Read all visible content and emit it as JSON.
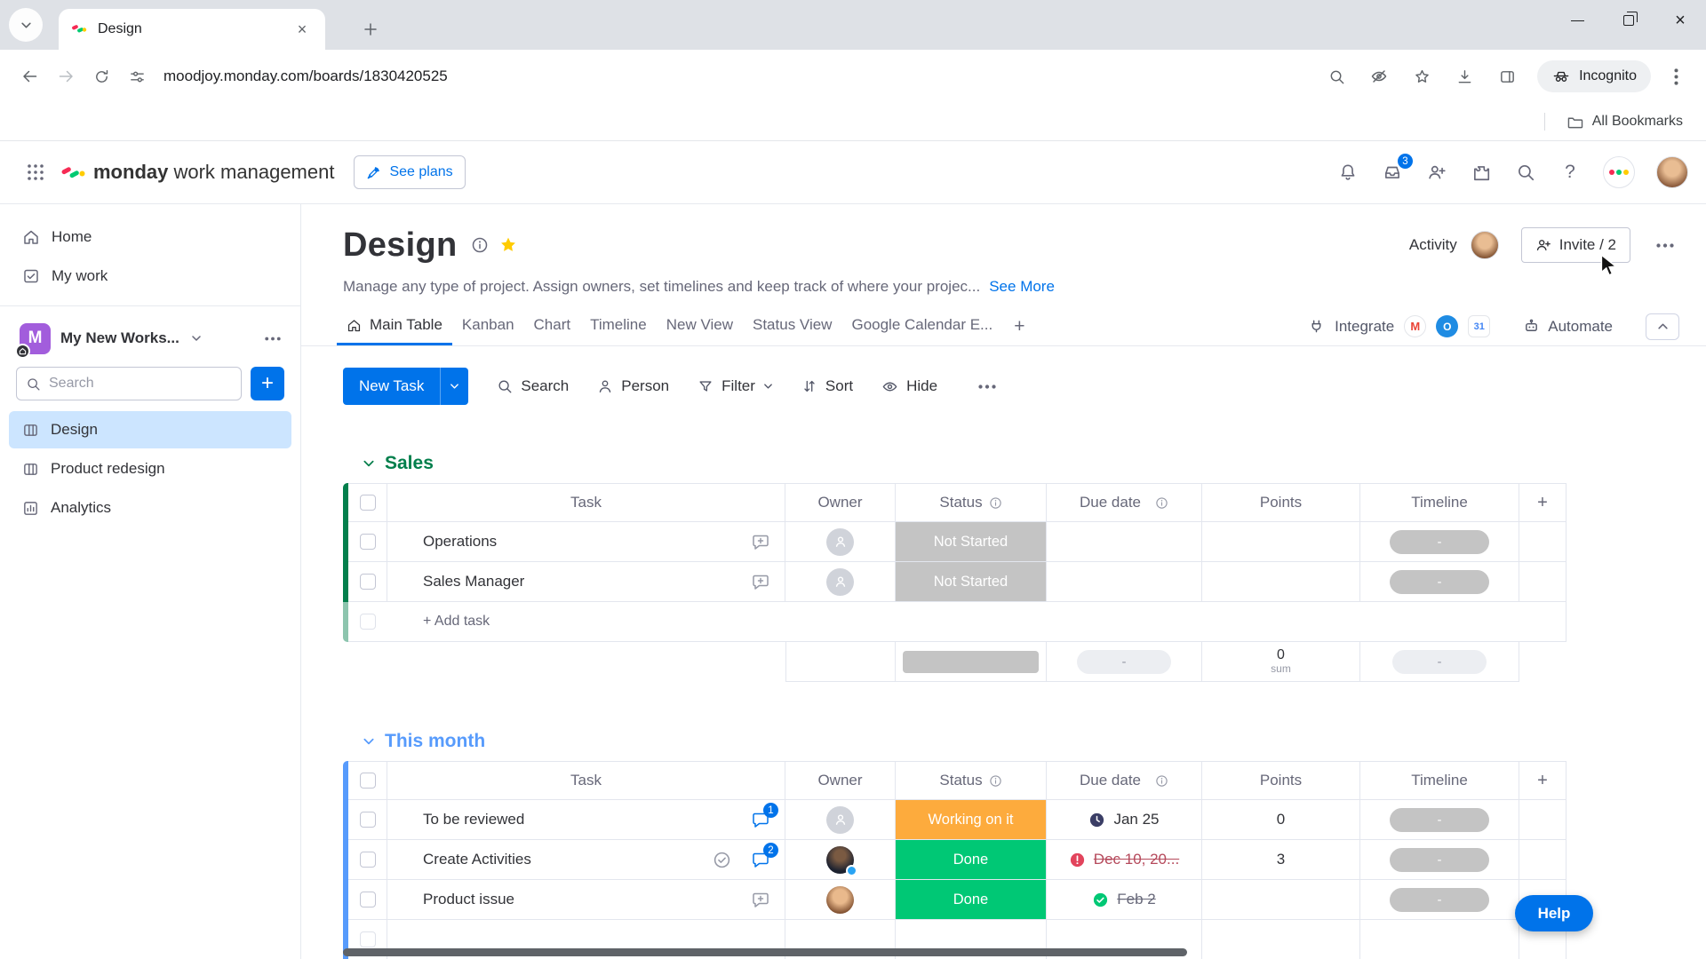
{
  "icons": {
    "plus": "+",
    "close": "×",
    "question": "?"
  },
  "colors": {
    "accent_blue": "#0073ea",
    "group_sales_green": "#037f4c",
    "group_this_month_blue": "#579bfc",
    "status_not_started": "#c4c4c4",
    "status_working_on_it": "#fdab3d",
    "status_done": "#00c875",
    "overdue_red": "#e2445c",
    "favorite_star_yellow": "#ffcb00",
    "selected_board_bg": "#cce5ff",
    "workspace_tile_purple": "#a25ddc"
  },
  "browser": {
    "tab": {
      "title": "Design"
    },
    "address": {
      "url": "moodjoy.monday.com/boards/1830420525"
    },
    "incognito_label": "Incognito",
    "bookmarks_label": "All Bookmarks"
  },
  "topnav": {
    "logo_primary": "monday",
    "logo_secondary": "work management",
    "see_plans_label": "See plans",
    "inbox_badge": "3"
  },
  "sidebar": {
    "nav": [
      {
        "label": "Home"
      },
      {
        "label": "My work"
      }
    ],
    "workspace": {
      "name": "My New Works...",
      "avatar_letter": "M"
    },
    "search": {
      "placeholder": "Search"
    },
    "boards": [
      {
        "label": "Design"
      },
      {
        "label": "Product redesign"
      },
      {
        "label": "Analytics"
      }
    ]
  },
  "board": {
    "title": "Design",
    "activity_label": "Activity",
    "invite_label": "Invite / 2",
    "description": "Manage any type of project. Assign owners, set timelines and keep track of where your projec...",
    "see_more_label": "See More",
    "views": [
      {
        "label": "Main Table"
      },
      {
        "label": "Kanban"
      },
      {
        "label": "Chart"
      },
      {
        "label": "Timeline"
      },
      {
        "label": "New View"
      },
      {
        "label": "Status View"
      },
      {
        "label": "Google Calendar E..."
      }
    ],
    "add_view_label": "+",
    "integrate_label": "Integrate",
    "automate_label": "Automate",
    "toolbar": {
      "new_task_label": "New Task",
      "search_label": "Search",
      "person_label": "Person",
      "filter_label": "Filter",
      "sort_label": "Sort",
      "hide_label": "Hide"
    }
  },
  "table": {
    "columns": {
      "task": "Task",
      "owner": "Owner",
      "status": "Status",
      "due": "Due date",
      "points": "Points",
      "timeline": "Timeline",
      "add": "+"
    }
  },
  "groups": {
    "sales": {
      "name": "Sales",
      "rows": [
        {
          "task": "Operations",
          "status": "Not Started",
          "due": "",
          "points": "",
          "timeline": "-"
        },
        {
          "task": "Sales Manager",
          "status": "Not Started",
          "due": "",
          "points": "",
          "timeline": "-"
        }
      ],
      "add_task_label": "+ Add task",
      "summary": {
        "due": "-",
        "points_value": "0",
        "points_unit": "sum",
        "timeline": "-"
      }
    },
    "this_month": {
      "name": "This month",
      "rows": [
        {
          "task": "To be reviewed",
          "updates_badge": "1",
          "status": "Working on it",
          "due": "Jan 25",
          "points": "0",
          "timeline": "-"
        },
        {
          "task": "Create Activities",
          "updates_badge": "2",
          "status": "Done",
          "due": "Dec 10, 20...",
          "points": "3",
          "timeline": "-"
        },
        {
          "task": "Product issue",
          "status": "Done",
          "due": "Feb 2",
          "points": "",
          "timeline": "-"
        }
      ]
    }
  },
  "help_label": "Help"
}
